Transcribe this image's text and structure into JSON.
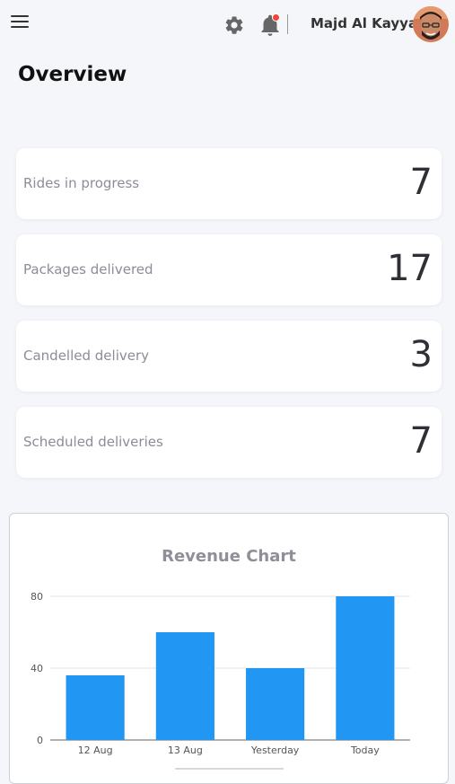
{
  "header": {
    "menu_icon": "hamburger-menu-icon",
    "settings_icon": "gear-icon",
    "notifications_icon": "bell-icon",
    "notification_dot_color": "#f0443a",
    "user_name": "Majd Al Kayyal"
  },
  "page": {
    "title": "Overview"
  },
  "stats": [
    {
      "label": "Rides in progress",
      "value": "7"
    },
    {
      "label": "Packages delivered",
      "value": "17"
    },
    {
      "label": "Candelled delivery",
      "value": "3"
    },
    {
      "label": "Scheduled deliveries",
      "value": "7"
    }
  ],
  "chart": {
    "title": "Revenue Chart"
  },
  "chart_data": {
    "type": "bar",
    "title": "Revenue Chart",
    "categories": [
      "12 Aug",
      "13 Aug",
      "Yesterday",
      "Today"
    ],
    "values": [
      36,
      60,
      40,
      80
    ],
    "yticks": [
      0,
      40,
      80
    ],
    "ylim": [
      0,
      80
    ],
    "bar_color": "#2196f3",
    "grid": true
  }
}
